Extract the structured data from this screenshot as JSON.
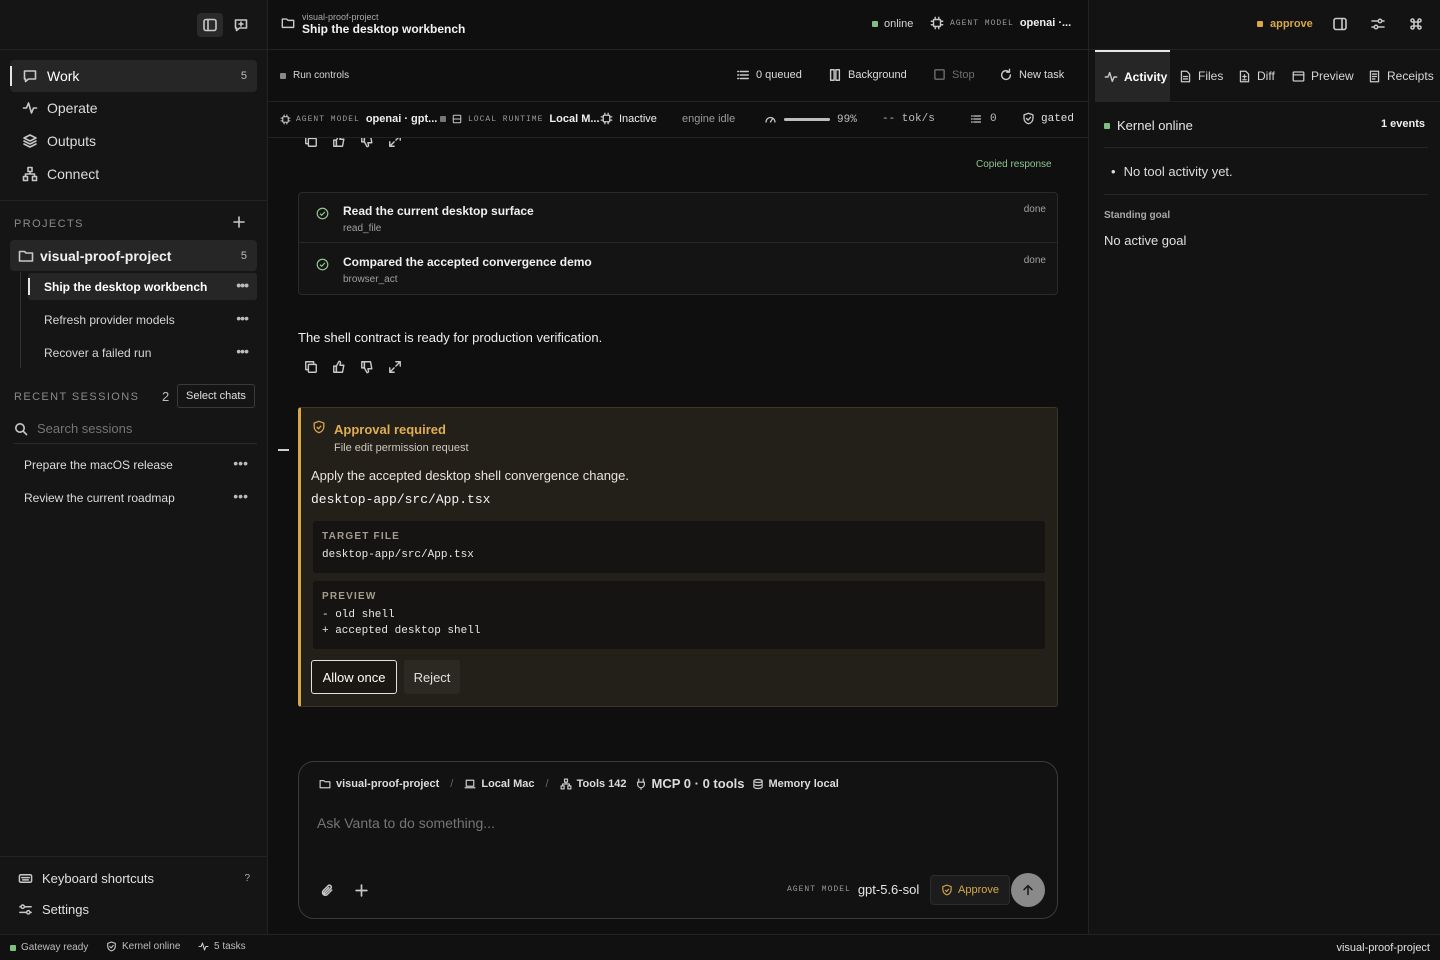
{
  "colors": {
    "accent_amber": "#d9a74a",
    "online_green": "#7fbf7f",
    "bg": "#0f0f0f"
  },
  "sidebar": {
    "nav": [
      {
        "label": "Work",
        "count": "5",
        "icon": "chat-bubble-icon"
      },
      {
        "label": "Operate",
        "icon": "pulse-icon"
      },
      {
        "label": "Outputs",
        "icon": "layers-icon"
      },
      {
        "label": "Connect",
        "icon": "network-icon"
      }
    ],
    "projects_title": "PROJECTS",
    "project": {
      "name": "visual-proof-project",
      "count": "5"
    },
    "tasks": [
      {
        "label": "Ship the desktop workbench"
      },
      {
        "label": "Refresh provider models"
      },
      {
        "label": "Recover a failed run"
      }
    ],
    "recent_title": "RECENT SESSIONS",
    "recent_count": "2",
    "select_chats": "Select chats",
    "search_placeholder": "Search sessions",
    "sessions": [
      {
        "label": "Prepare the macOS release"
      },
      {
        "label": "Review the current roadmap"
      }
    ],
    "keyboard_shortcuts": "Keyboard shortcuts",
    "shortcut_key": "?",
    "settings": "Settings"
  },
  "header": {
    "project": "visual-proof-project",
    "title": "Ship the desktop workbench",
    "online": "online",
    "agent_model_label": "AGENT MODEL",
    "agent_model_value": "openai ·...",
    "approve": "approve"
  },
  "run_controls": {
    "label": "Run controls",
    "queued": "0 queued",
    "background": "Background",
    "stop": "Stop",
    "new_task": "New task"
  },
  "model_bar": {
    "agent_model_label": "AGENT MODEL",
    "agent_model_value": "openai · gpt...",
    "runtime_label": "LOCAL RUNTIME",
    "runtime_value": "Local M...",
    "state": "Inactive",
    "engine": "engine idle",
    "gauge": "99%",
    "gauge_fraction": 0.99,
    "tok": "-- tok/s",
    "queue": "0",
    "gated": "gated"
  },
  "chat": {
    "copied": "Copied response",
    "steps": [
      {
        "title": "Read the current desktop surface",
        "tool": "read_file",
        "status": "done"
      },
      {
        "title": "Compared the accepted convergence demo",
        "tool": "browser_act",
        "status": "done"
      }
    ],
    "message": "The shell contract is ready for production verification."
  },
  "approval": {
    "title": "Approval required",
    "subtitle": "File edit permission request",
    "description": "Apply the accepted desktop shell convergence change.",
    "path": "desktop-app/src/App.tsx",
    "target_label": "TARGET FILE",
    "target_value": "desktop-app/src/App.tsx",
    "preview_label": "PREVIEW",
    "preview_lines": [
      "- old shell",
      "+ accepted desktop shell"
    ],
    "allow": "Allow once",
    "reject": "Reject"
  },
  "composer": {
    "project": "visual-proof-project",
    "local": "Local Mac",
    "tools": "Tools 142",
    "mcp": "MCP 0 · 0 tools",
    "memory": "Memory local",
    "placeholder": "Ask Vanta to do something...",
    "model_label": "AGENT MODEL",
    "model_value": "gpt-5.6-sol",
    "approve": "Approve"
  },
  "right": {
    "tabs": [
      {
        "label": "Activity",
        "icon": "pulse-icon"
      },
      {
        "label": "Files",
        "icon": "file-icon"
      },
      {
        "label": "Diff",
        "icon": "diff-icon"
      },
      {
        "label": "Preview",
        "icon": "window-icon"
      },
      {
        "label": "Receipts",
        "icon": "receipt-icon"
      }
    ],
    "kernel": "Kernel online",
    "events": "1 events",
    "no_activity": "No tool activity yet.",
    "goal_label": "Standing goal",
    "goal_value": "No active goal"
  },
  "statusbar": {
    "gateway": "Gateway ready",
    "kernel": "Kernel online",
    "tasks": "5 tasks",
    "project": "visual-proof-project"
  }
}
